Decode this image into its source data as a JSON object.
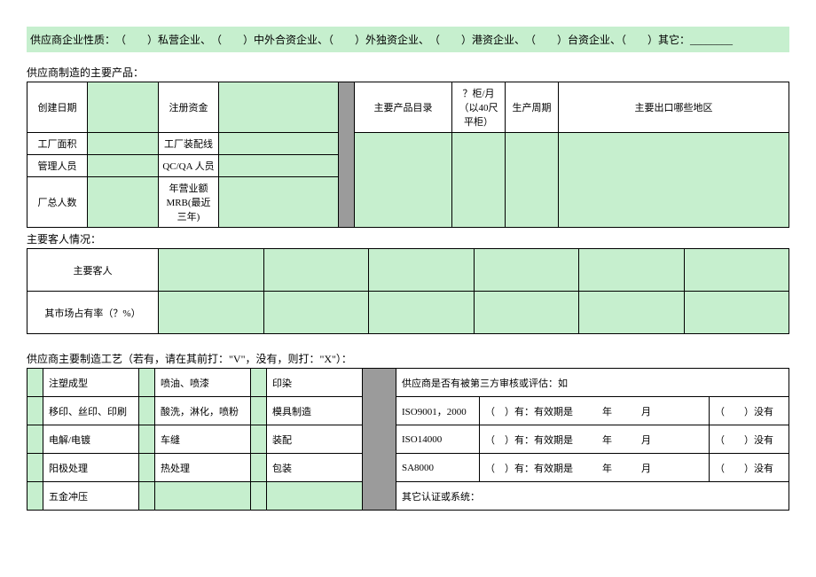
{
  "topBanner": "供应商企业性质：　（　　）私营企业、　（　　）中外合资企业、（　　）外独资企业、　（　　）港资企业、　（　　）台资企业、（　　）其它：________",
  "section1": {
    "title": "供应商制造的主要产品：",
    "row1": {
      "c1": "创建日期",
      "c2": "注册资金",
      "c3": "主要产品目录",
      "c4": "？柜/月（以40尺平柜）",
      "c5": "生产周期",
      "c6": "主要出口哪些地区"
    },
    "row2": {
      "c1": "工厂面积",
      "c2": "工厂装配线"
    },
    "row3": {
      "c1": "管理人员",
      "c2": "QC/QA 人员"
    },
    "row4": {
      "c1": "厂总人数",
      "c2": "年营业额MRB(最近三年)"
    }
  },
  "section2": {
    "title": "主要客人情况：",
    "row1": "主要客人",
    "row2": "其市场占有率（？%）"
  },
  "section3": {
    "title": "供应商主要制造工艺（若有，请在其前打：\"V\"，没有，则打：\"X\"）：",
    "rows": [
      {
        "a": "注塑成型",
        "b": "喷油、喷漆",
        "c": "印染",
        "right": "供应商是否有被第三方审核或评估：如"
      },
      {
        "a": "移印、丝印、印刷",
        "b": "酸洗，淋化，喷粉",
        "c": "模具制造",
        "r1": "ISO9001，2000",
        "r2": "（　）有：有效期是　　　年　　　月",
        "r3": "（　　）没有"
      },
      {
        "a": "电解/电镀",
        "b": "车缝",
        "c": "装配",
        "r1": "ISO14000",
        "r2": "（　）有：有效期是　　　年　　　月",
        "r3": "（　　）没有"
      },
      {
        "a": "阳极处理",
        "b": "热处理",
        "c": "包装",
        "r1": "SA8000",
        "r2": "（　）有：有效期是　　　年　　　月",
        "r3": "（　　）没有"
      },
      {
        "a": "五金冲压",
        "right": "其它认证或系统："
      }
    ]
  }
}
